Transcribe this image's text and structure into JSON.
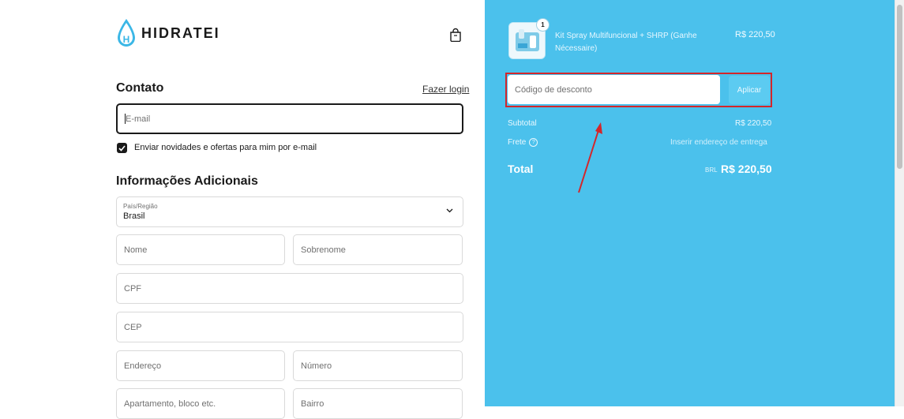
{
  "brand": {
    "name": "HIDRATEI"
  },
  "contact": {
    "title": "Contato",
    "login_link": "Fazer login",
    "email_placeholder": "E-mail",
    "newsletter_label": "Enviar novidades e ofertas para mim por e-mail",
    "newsletter_checked": true
  },
  "additional": {
    "title": "Informações Adicionais",
    "country_label": "País/Região",
    "country_value": "Brasil",
    "first_name": "Nome",
    "last_name": "Sobrenome",
    "cpf": "CPF",
    "cep": "CEP",
    "address": "Endereço",
    "number": "Número",
    "apartment": "Apartamento, bloco etc.",
    "neighborhood": "Bairro"
  },
  "summary": {
    "item": {
      "quantity": "1",
      "title": "Kit Spray Multifuncional + SHRP (Ganhe Nécessaire)",
      "price": "R$ 220,50"
    },
    "discount_placeholder": "Código de desconto",
    "apply_label": "Aplicar",
    "subtotal_label": "Subtotal",
    "subtotal_value": "R$ 220,50",
    "shipping_label": "Frete",
    "shipping_value": "Inserir endereço de entrega",
    "total_label": "Total",
    "total_currency": "BRL",
    "total_value": "R$ 220,50"
  },
  "colors": {
    "summary_bg": "#4bc1ec",
    "highlight_box": "#d4262a",
    "arrow": "#d4262a"
  },
  "icons": [
    "water-drop-logo-icon",
    "shopping-bag-icon",
    "checkmark-icon",
    "chevron-down-icon",
    "info-icon",
    "annotation-arrow-icon"
  ]
}
